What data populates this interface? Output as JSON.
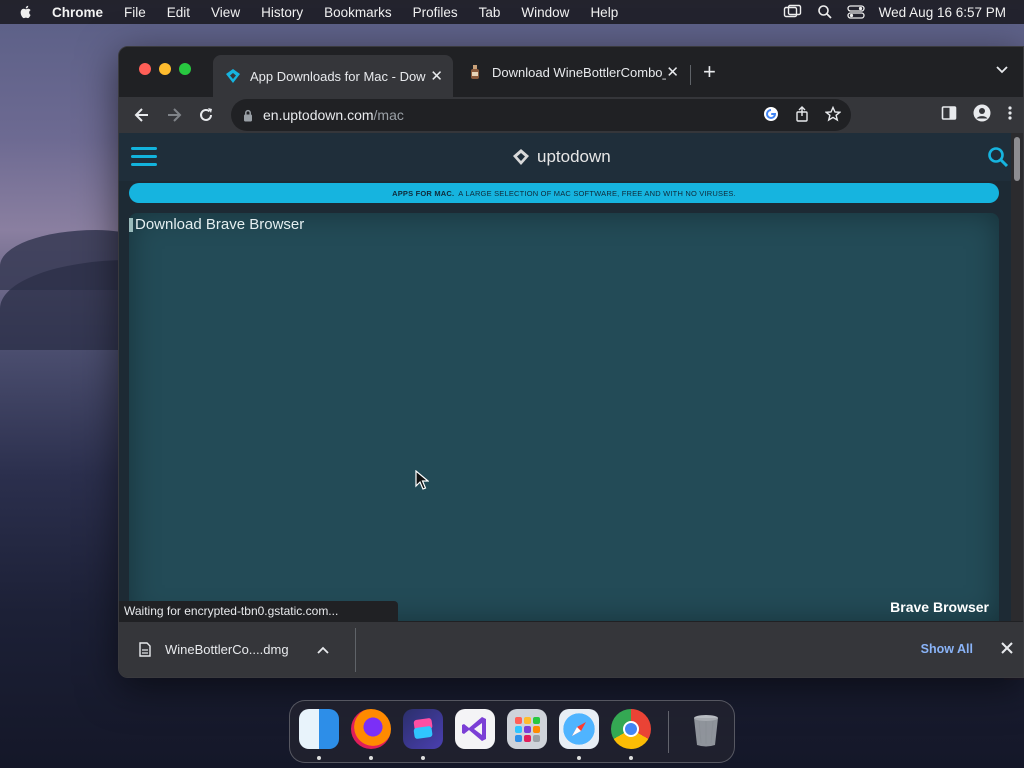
{
  "menubar": {
    "app_name": "Chrome",
    "items": [
      "File",
      "Edit",
      "View",
      "History",
      "Bookmarks",
      "Profiles",
      "Tab",
      "Window",
      "Help"
    ],
    "datetime": "Wed Aug 16  6:57 PM"
  },
  "browser": {
    "tabs": [
      {
        "title": "App Downloads for Mac - Download",
        "active": true
      },
      {
        "title": "Download WineBottlerCombo_",
        "active": false
      }
    ],
    "url_host": "en.uptodown.com",
    "url_path": "/mac"
  },
  "page": {
    "logo_text": "uptodown",
    "banner_bold": "APPS FOR MAC.",
    "banner_text": "A LARGE SELECTION OF MAC SOFTWARE, FREE AND WITH NO VIRUSES.",
    "hero_alt": "Download Brave Browser",
    "hero_caption": "Brave Browser",
    "status_text": "Waiting for encrypted-tbn0.gstatic.com..."
  },
  "downloads": {
    "filename": "WineBottlerCo....dmg",
    "show_all": "Show All"
  },
  "colors": {
    "accent": "#16b4df",
    "hero_bg": "#234b57",
    "link": "#8ab4f8"
  },
  "dock": {
    "apps": [
      "Finder",
      "Firefox",
      "Shortcuts",
      "Visual Studio",
      "Launchpad",
      "Safari",
      "Chrome",
      "Trash"
    ]
  }
}
